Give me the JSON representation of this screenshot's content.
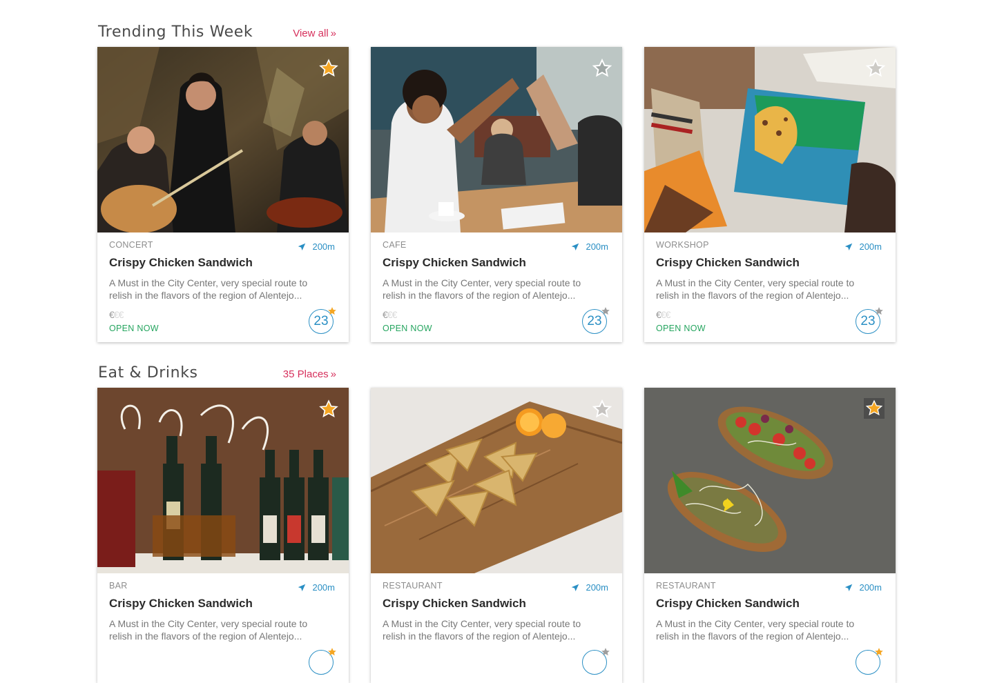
{
  "colors": {
    "accent_link": "#d6305c",
    "distance_blue": "#2a8fc4",
    "open_green": "#25a55f",
    "star_orange": "#f5a623"
  },
  "sections": [
    {
      "title": "Trending This Week",
      "link_label": "View all",
      "cards": [
        {
          "category": "CONCERT",
          "distance": "200m",
          "title": "Crispy Chicken Sandwich",
          "description": "A Must in the City Center, very special route to relish in the flavors of the region of Alentejo...",
          "price_symbols": "€€€",
          "price_level": 1,
          "status": "OPEN NOW",
          "rating": "23",
          "favorited": true,
          "image_icon": "concert-photo"
        },
        {
          "category": "CAFE",
          "distance": "200m",
          "title": "Crispy Chicken Sandwich",
          "description": "A Must in the City Center, very special route to relish in the flavors of the region of Alentejo...",
          "price_symbols": "€€€",
          "price_level": 1,
          "status": "OPEN NOW",
          "rating": "23",
          "favorited": false,
          "image_icon": "cafe-photo"
        },
        {
          "category": "WORKSHOP",
          "distance": "200m",
          "title": "Crispy Chicken Sandwich",
          "description": "A Must in the City Center, very special route to relish in the flavors of the region of Alentejo...",
          "price_symbols": "€€€",
          "price_level": 1,
          "status": "OPEN NOW",
          "rating": "23",
          "favorited": false,
          "image_icon": "workshop-photo"
        }
      ]
    },
    {
      "title": "Eat & Drinks",
      "link_label": "35 Places",
      "cards": [
        {
          "category": "BAR",
          "distance": "200m",
          "title": "Crispy Chicken Sandwich",
          "description": "A Must in the City Center, very special route to relish in the flavors of the region of Alentejo...",
          "rating_star": "orange",
          "favorited": true,
          "image_icon": "bar-photo"
        },
        {
          "category": "RESTAURANT",
          "distance": "200m",
          "title": "Crispy Chicken Sandwich",
          "description": "A Must in the City Center, very special route to relish in the flavors of the region of Alentejo...",
          "rating_star": "gray",
          "favorited": false,
          "image_icon": "samosa-photo"
        },
        {
          "category": "RESTAURANT",
          "distance": "200m",
          "title": "Crispy Chicken Sandwich",
          "description": "A Must in the City Center, very special route to relish in the flavors of the region of Alentejo...",
          "rating_star": "orange",
          "favorited": true,
          "image_icon": "toast-photo"
        }
      ]
    }
  ]
}
